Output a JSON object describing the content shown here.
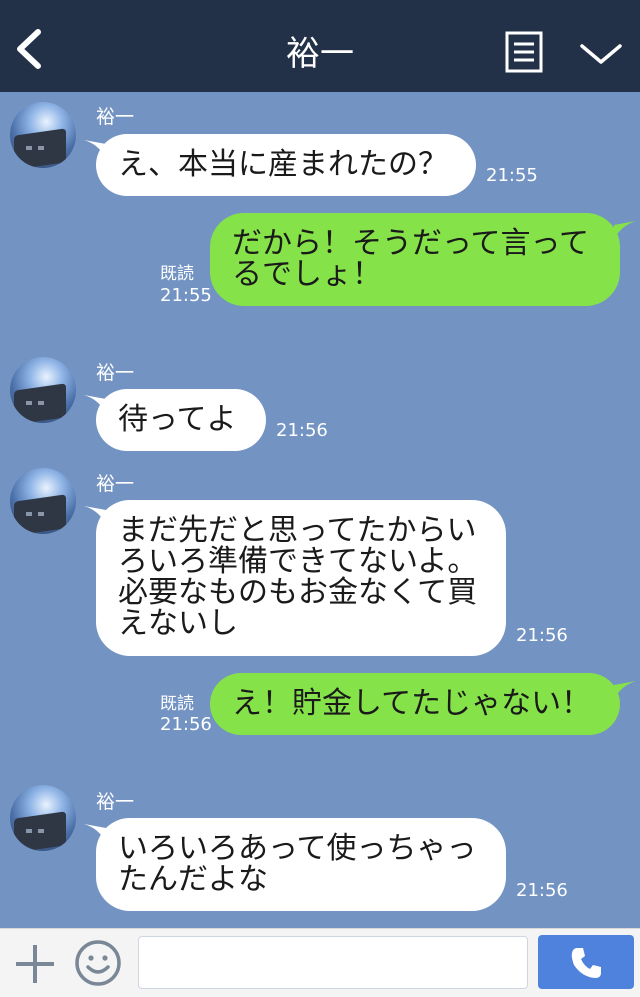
{
  "header": {
    "title": "裕一"
  },
  "messages": [
    {
      "sender": "裕一",
      "text": "え、本当に産まれたの？",
      "time": "21:55"
    },
    {
      "text": "だから！そうだって言って\nるでしょ！",
      "read": "既読",
      "time": "21:55"
    },
    {
      "sender": "裕一",
      "text": "待ってよ",
      "time": "21:56"
    },
    {
      "sender": "裕一",
      "text": "まだ先だと思ってたからい\nろいろ準備できてないよ。\n必要なものもお金なくて買\nえないし",
      "time": "21:56"
    },
    {
      "text": "え！貯金してたじゃない！",
      "read": "既読",
      "time": "21:56"
    },
    {
      "sender": "裕一",
      "text": "いろいろあって使っちゃっ\nたんだよな",
      "time": "21:56"
    }
  ],
  "input": {
    "placeholder": ""
  },
  "icons": {
    "back": "chevron-left-icon",
    "menu": "note-menu-icon",
    "collapse": "chevron-down-icon",
    "add": "plus-icon",
    "emoji": "smiley-icon",
    "call": "phone-icon"
  },
  "colors": {
    "header": "#223048",
    "chat_background": "#7393c3",
    "incoming_bubble": "#ffffff",
    "outgoing_bubble": "#85e249",
    "call_button": "#4f82dd"
  }
}
